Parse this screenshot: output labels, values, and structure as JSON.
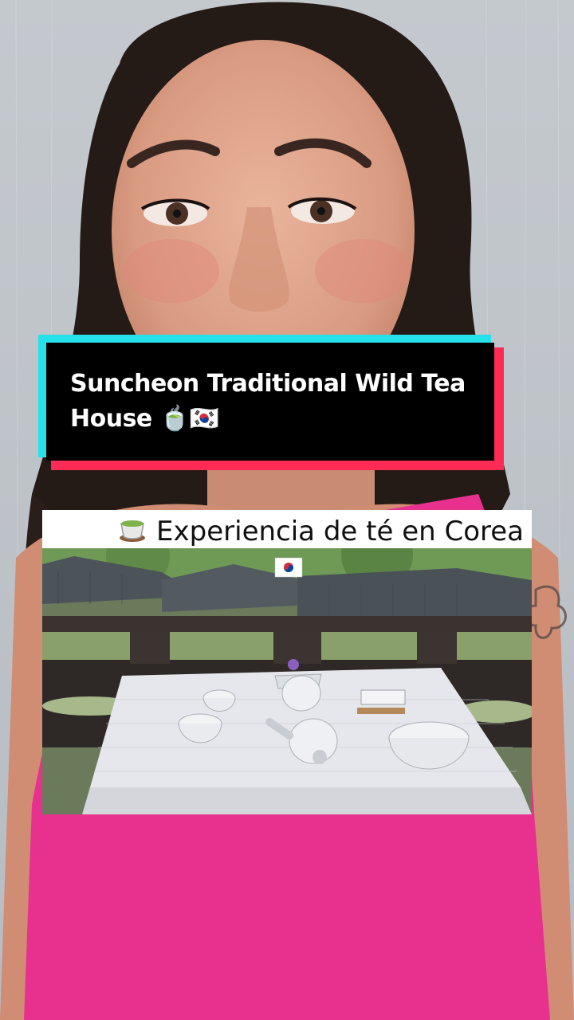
{
  "overlay": {
    "title": "Suncheon Traditional Wild Tea House 🍵🇰🇷",
    "caption": "Experiencia de té en Corea",
    "caption_icon": "tea-cup-icon",
    "flag_icon": "korea-flag-icon"
  },
  "colors": {
    "cyan": "#25e1ea",
    "red": "#fe2c55",
    "shirt": "#e8318f",
    "wall": "#c9cdd1"
  }
}
